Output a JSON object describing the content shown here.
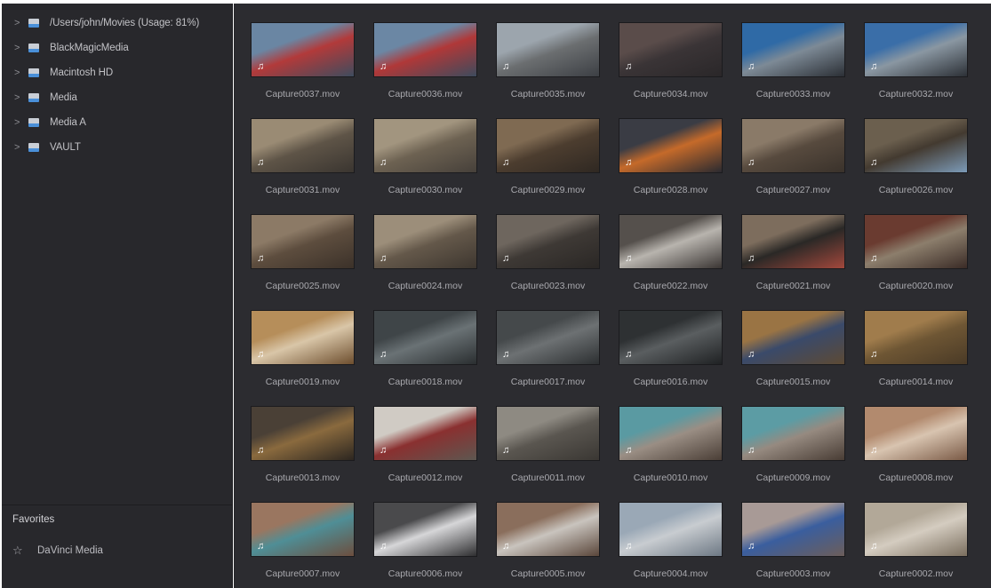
{
  "sidebar": {
    "tree": [
      {
        "label": "/Users/john/Movies (Usage: 81%)",
        "icon": "drive-icon"
      },
      {
        "label": "BlackMagicMedia",
        "icon": "drive-icon"
      },
      {
        "label": "Macintosh HD",
        "icon": "drive-icon"
      },
      {
        "label": "Media",
        "icon": "drive-icon"
      },
      {
        "label": "Media A",
        "icon": "drive-icon"
      },
      {
        "label": "VAULT",
        "icon": "drive-icon"
      }
    ],
    "chevron": ">",
    "favorites_title": "Favorites",
    "favorites": [
      {
        "label": "DaVinci Media",
        "icon": "star-icon"
      }
    ]
  },
  "media": {
    "audio_glyph": "♫",
    "clips": [
      {
        "name": "Capture0037.mov",
        "colors": [
          "#6a86a3",
          "#b23a3a",
          "#3e4c5e"
        ]
      },
      {
        "name": "Capture0036.mov",
        "colors": [
          "#6b87a4",
          "#b03838",
          "#3d4b5d"
        ]
      },
      {
        "name": "Capture0035.mov",
        "colors": [
          "#9ca5ad",
          "#6b6e70",
          "#3c3f44"
        ]
      },
      {
        "name": "Capture0034.mov",
        "colors": [
          "#5a4c4a",
          "#3a3436",
          "#2a2729"
        ]
      },
      {
        "name": "Capture0033.mov",
        "colors": [
          "#2f6aa6",
          "#7d8a96",
          "#2b2f35"
        ]
      },
      {
        "name": "Capture0032.mov",
        "colors": [
          "#3a6ea8",
          "#8a97a2",
          "#2c3036"
        ]
      },
      {
        "name": "Capture0031.mov",
        "colors": [
          "#9a8b74",
          "#5e5447",
          "#3a3530"
        ]
      },
      {
        "name": "Capture0030.mov",
        "colors": [
          "#a2957f",
          "#6d6252",
          "#46403a"
        ]
      },
      {
        "name": "Capture0029.mov",
        "colors": [
          "#7f6a52",
          "#4c3d2f",
          "#2f2822"
        ]
      },
      {
        "name": "Capture0028.mov",
        "colors": [
          "#3a3c44",
          "#c56a2a",
          "#2a2a30"
        ]
      },
      {
        "name": "Capture0027.mov",
        "colors": [
          "#8a7a68",
          "#574a3e",
          "#3a322b"
        ]
      },
      {
        "name": "Capture0026.mov",
        "colors": [
          "#6b5f4e",
          "#433a30",
          "#7c9bb8"
        ]
      },
      {
        "name": "Capture0025.mov",
        "colors": [
          "#8c7a66",
          "#5d4d3e",
          "#3b3129"
        ]
      },
      {
        "name": "Capture0024.mov",
        "colors": [
          "#9c8e7a",
          "#64584a",
          "#3d362f"
        ]
      },
      {
        "name": "Capture0023.mov",
        "colors": [
          "#6e665e",
          "#3e3935",
          "#2a2725"
        ]
      },
      {
        "name": "Capture0022.mov",
        "colors": [
          "#55504c",
          "#b8b4ae",
          "#3a3533"
        ]
      },
      {
        "name": "Capture0021.mov",
        "colors": [
          "#7d6d5d",
          "#2a2826",
          "#a3483c"
        ]
      },
      {
        "name": "Capture0020.mov",
        "colors": [
          "#6a3b30",
          "#8c7e6c",
          "#3a2b26"
        ]
      },
      {
        "name": "Capture0019.mov",
        "colors": [
          "#b68e5a",
          "#d9c6a8",
          "#6d4e2e"
        ]
      },
      {
        "name": "Capture0018.mov",
        "colors": [
          "#3f4548",
          "#6a7275",
          "#2a2e30"
        ]
      },
      {
        "name": "Capture0017.mov",
        "colors": [
          "#45494b",
          "#6d7173",
          "#2c2f31"
        ]
      },
      {
        "name": "Capture0016.mov",
        "colors": [
          "#2e3133",
          "#5a5e60",
          "#1f2123"
        ]
      },
      {
        "name": "Capture0015.mov",
        "colors": [
          "#9a7444",
          "#3a4a6a",
          "#5d4a34"
        ]
      },
      {
        "name": "Capture0014.mov",
        "colors": [
          "#a07c4c",
          "#6e5634",
          "#4a3a26"
        ]
      },
      {
        "name": "Capture0013.mov",
        "colors": [
          "#4a4036",
          "#8a6a3e",
          "#2c2620"
        ]
      },
      {
        "name": "Capture0012.mov",
        "colors": [
          "#d0cbc4",
          "#8a3030",
          "#5d5750"
        ]
      },
      {
        "name": "Capture0011.mov",
        "colors": [
          "#8e8a82",
          "#5a5650",
          "#3a3733"
        ]
      },
      {
        "name": "Capture0010.mov",
        "colors": [
          "#5a9aa2",
          "#9a8e84",
          "#4a3e36"
        ]
      },
      {
        "name": "Capture0009.mov",
        "colors": [
          "#5c9ca4",
          "#968a80",
          "#483c34"
        ]
      },
      {
        "name": "Capture0008.mov",
        "colors": [
          "#b28a6e",
          "#d8c4b0",
          "#7a5a46"
        ]
      },
      {
        "name": "Capture0007.mov",
        "colors": [
          "#9a7660",
          "#4f8e96",
          "#6c4e3e"
        ]
      },
      {
        "name": "Capture0006.mov",
        "colors": [
          "#4a4a4c",
          "#d6d6d8",
          "#2e2e30"
        ]
      },
      {
        "name": "Capture0005.mov",
        "colors": [
          "#8a6e5c",
          "#c9c4be",
          "#5a463a"
        ]
      },
      {
        "name": "Capture0004.mov",
        "colors": [
          "#9aa8b6",
          "#c8ccd0",
          "#6d7884"
        ]
      },
      {
        "name": "Capture0003.mov",
        "colors": [
          "#a89a96",
          "#3a5e9e",
          "#6c5e5a"
        ]
      },
      {
        "name": "Capture0002.mov",
        "colors": [
          "#b2a898",
          "#d4ccc0",
          "#7a6e5e"
        ]
      }
    ]
  }
}
